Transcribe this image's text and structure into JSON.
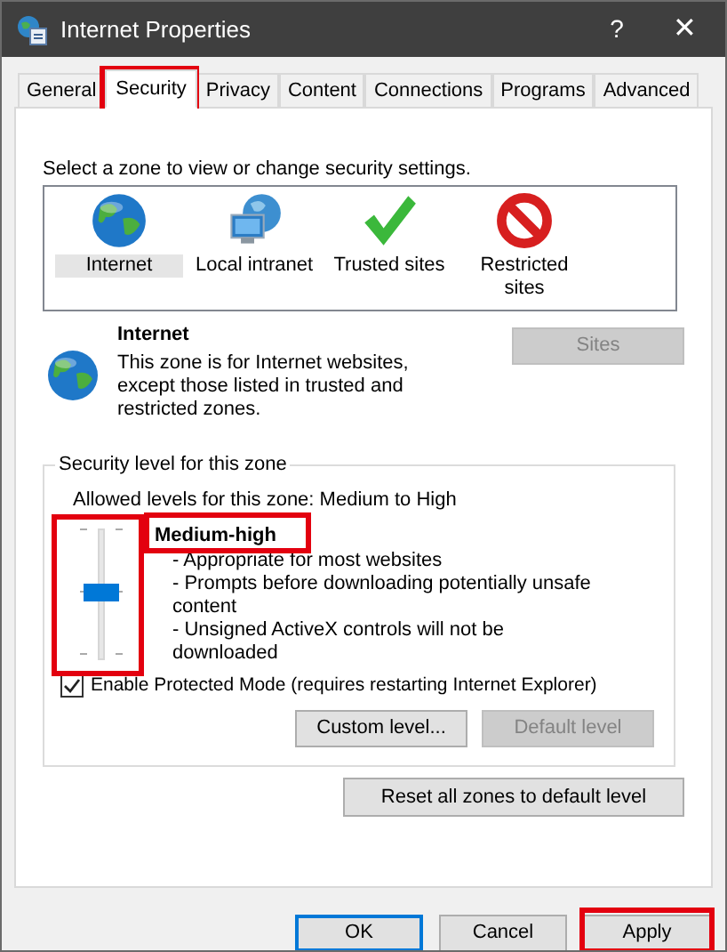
{
  "window": {
    "title": "Internet Properties",
    "help": "?",
    "close": "✕"
  },
  "tabs": [
    {
      "label": "General",
      "selected": false
    },
    {
      "label": "Security",
      "selected": true
    },
    {
      "label": "Privacy",
      "selected": false
    },
    {
      "label": "Content",
      "selected": false
    },
    {
      "label": "Connections",
      "selected": false
    },
    {
      "label": "Programs",
      "selected": false
    },
    {
      "label": "Advanced",
      "selected": false
    }
  ],
  "zone_prompt": "Select a zone to view or change security settings.",
  "zones": [
    {
      "label": "Internet",
      "kind": "globe",
      "selected": true
    },
    {
      "label": "Local intranet",
      "kind": "network",
      "selected": false
    },
    {
      "label": "Trusted sites",
      "kind": "check",
      "selected": false
    },
    {
      "label": "Restricted sites",
      "kind": "blocked",
      "selected": false
    }
  ],
  "zone_info": {
    "title": "Internet",
    "description": "This zone is for Internet websites, except those listed in trusted and restricted zones.",
    "sites_button": {
      "label": "Sites",
      "disabled": true
    }
  },
  "security_level": {
    "legend": "Security level for this zone",
    "allowed": "Allowed levels for this zone: Medium to High",
    "level": 0.5,
    "level_name": "Medium-high",
    "details": [
      "- Appropriate for most websites",
      "- Prompts before downloading potentially unsafe content",
      "- Unsigned ActiveX controls will not be downloaded"
    ],
    "protected_mode": {
      "label": "Enable Protected Mode (requires restarting Internet Explorer)",
      "checked": true
    },
    "buttons": [
      {
        "label": "Custom level...",
        "disabled": false
      },
      {
        "label": "Default level",
        "disabled": true
      }
    ]
  },
  "reset_button": {
    "label": "Reset all zones to default level"
  },
  "dialog_buttons": [
    {
      "label": "OK",
      "default": true
    },
    {
      "label": "Cancel",
      "default": false
    },
    {
      "label": "Apply",
      "default": false
    }
  ]
}
